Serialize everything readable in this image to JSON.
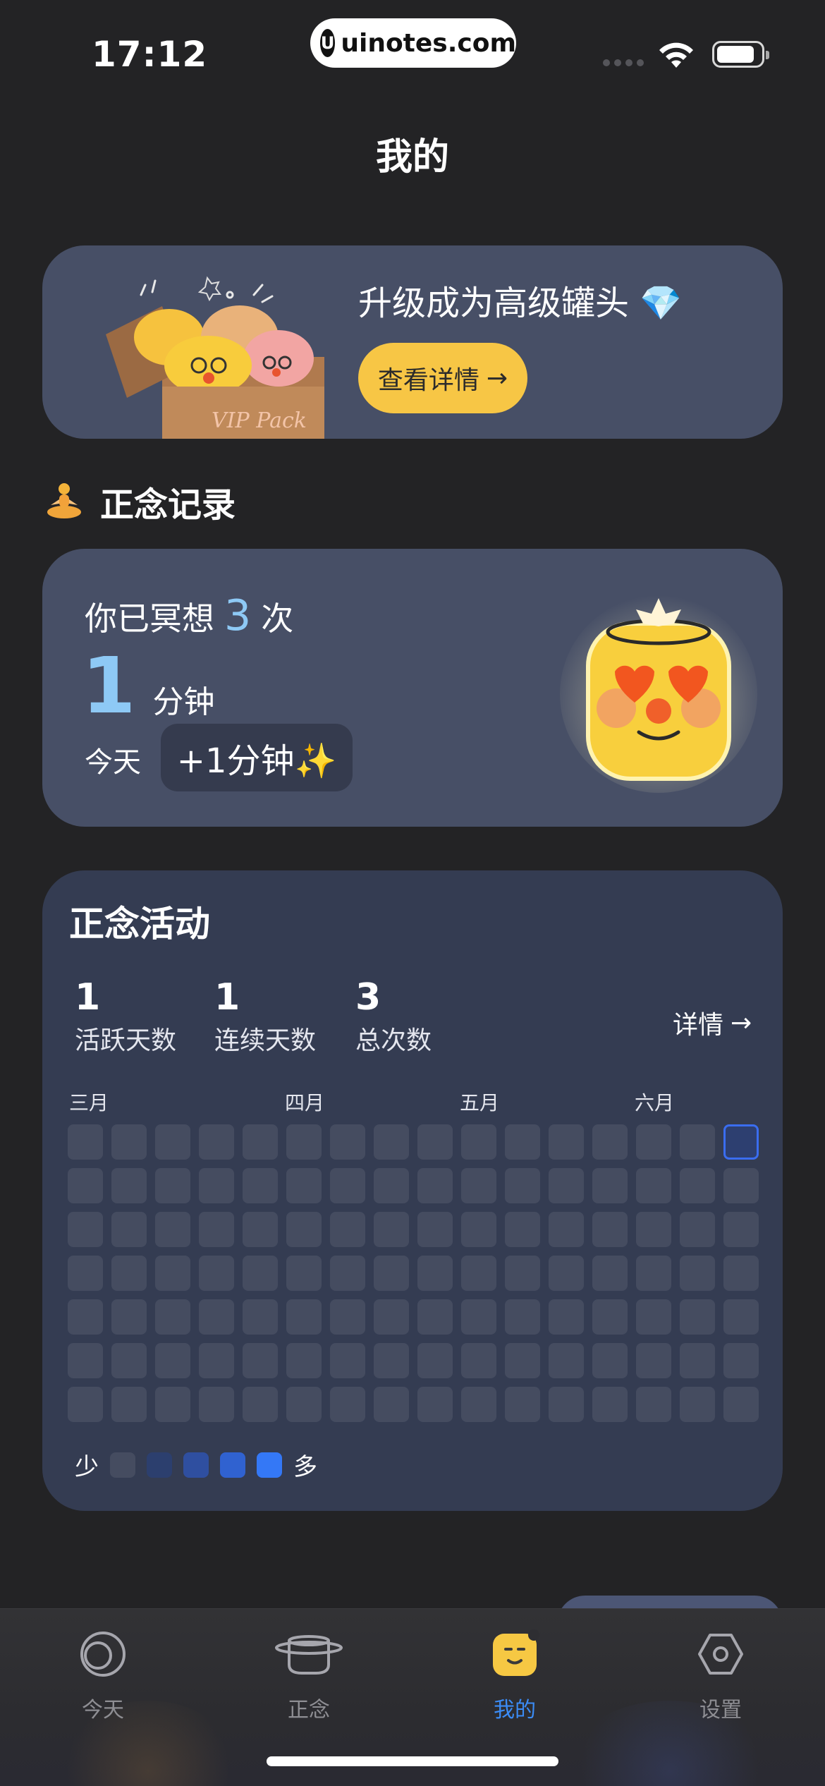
{
  "status_bar": {
    "time": "17:12",
    "url": "uinotes.com",
    "url_logo": "U"
  },
  "page": {
    "title": "我的"
  },
  "vip": {
    "title": "升级成为高级罐头 💎",
    "button": "查看详情",
    "button_arrow": "→",
    "box_text": "VIP Pack"
  },
  "section": {
    "emoji": "meditation-icon",
    "title": "正念记录"
  },
  "record": {
    "prefix": "你已冥想",
    "count": "3",
    "suffix": "次",
    "minutes": "1",
    "minutes_unit": "分钟",
    "today_label": "今天",
    "today_value": "+1分钟✨"
  },
  "activity": {
    "title": "正念活动",
    "stats": [
      {
        "value": "1",
        "label": "活跃天数"
      },
      {
        "value": "1",
        "label": "连续天数"
      },
      {
        "value": "3",
        "label": "总次数"
      }
    ],
    "detail": "详情",
    "detail_arrow": "→",
    "months": [
      "三月",
      "四月",
      "五月",
      "六月"
    ],
    "columns": 16,
    "rows": 7,
    "active_cells": [
      [
        0,
        15
      ]
    ],
    "legend_low": "少",
    "legend_high": "多",
    "legend_colors": [
      "#454c60",
      "#2c3f6e",
      "#2f4fa0",
      "#3062d0",
      "#3478f6"
    ]
  },
  "tabs": [
    {
      "label": "今天",
      "icon": "today-icon",
      "selected": false
    },
    {
      "label": "正念",
      "icon": "jar-icon",
      "selected": false
    },
    {
      "label": "我的",
      "icon": "profile-face-icon",
      "selected": true
    },
    {
      "label": "设置",
      "icon": "settings-hex-icon",
      "selected": false
    }
  ],
  "colors": {
    "accent": "#3b8cf6",
    "button_yellow": "#f7c645",
    "highlight_blue": "#8ec9f5",
    "card": "#474f66"
  }
}
